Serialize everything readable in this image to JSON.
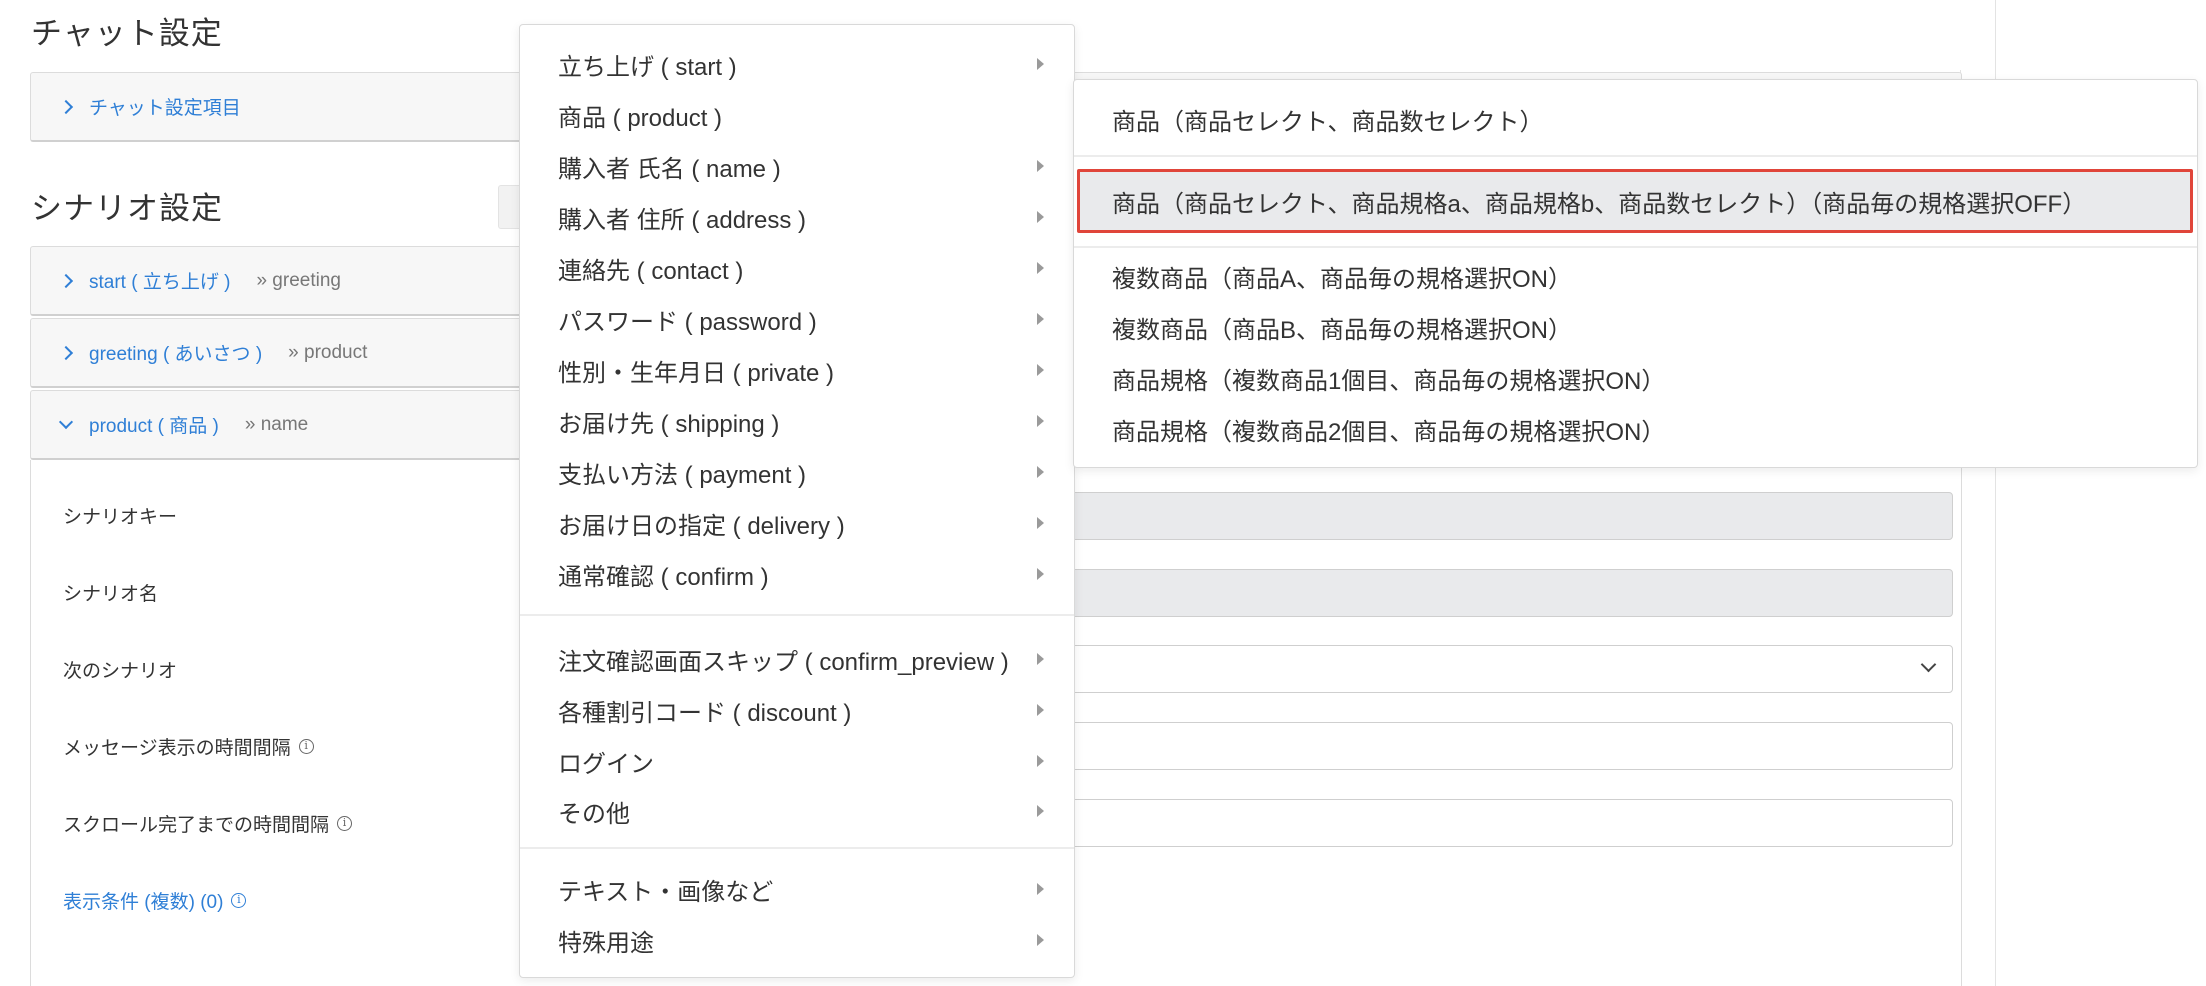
{
  "chat_section": {
    "title": "チャット設定",
    "item_label": "チャット設定項目"
  },
  "scenario_section": {
    "title": "シナリオ設定",
    "scenarios": [
      {
        "label": "start ( 立ち上げ )",
        "next": "» greeting"
      },
      {
        "label": "greeting ( あいさつ )",
        "next": "» product"
      },
      {
        "label": "product ( 商品 )",
        "next": "» name"
      }
    ]
  },
  "form": {
    "scenario_key_label": "シナリオキー",
    "scenario_name_label": "シナリオ名",
    "next_scenario_label": "次のシナリオ",
    "message_interval_label": "メッセージ表示の時間間隔",
    "scroll_interval_label": "スクロール完了までの時間間隔",
    "display_conditions_label": "表示条件 (複数) (0)",
    "info_glyph": "i"
  },
  "menu": {
    "items": [
      "立ち上げ ( start )",
      "商品 ( product )",
      "購入者 氏名 ( name )",
      "購入者 住所 ( address )",
      "連絡先 ( contact )",
      "パスワード ( password )",
      "性別・生年月日 ( private )",
      "お届け先 ( shipping )",
      "支払い方法 ( payment )",
      "お届け日の指定 ( delivery )",
      "通常確認 ( confirm )",
      "注文確認画面スキップ ( confirm_preview )",
      "各種割引コード ( discount )",
      "ログイン",
      "その他",
      "テキスト・画像など",
      "特殊用途"
    ]
  },
  "submenu": {
    "items": [
      "商品（商品セレクト、商品数セレクト）",
      "商品（商品セレクト、商品規格a、商品規格b、商品数セレクト）（商品毎の規格選択OFF）",
      "複数商品（商品A、商品毎の規格選択ON）",
      "複数商品（商品B、商品毎の規格選択ON）",
      "商品規格（複数商品1個目、商品毎の規格選択ON）",
      "商品規格（複数商品2個目、商品毎の規格選択ON）"
    ],
    "highlight_color": "#e0453a"
  },
  "colors": {
    "link": "#2f7fd6",
    "disabled_field": "#e9eaec"
  }
}
